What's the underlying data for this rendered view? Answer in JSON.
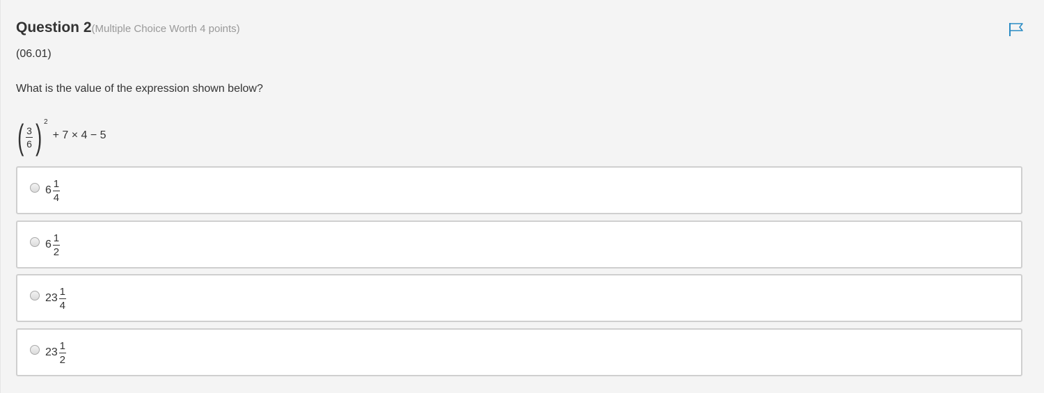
{
  "question": {
    "title": "Question 2",
    "subtitle": "(Multiple Choice Worth 4 points)",
    "code": "(06.01)",
    "prompt": "What is the value of the expression shown below?",
    "flag_icon": "flag-icon"
  },
  "expression": {
    "numerator": "3",
    "denominator": "6",
    "exponent": "2",
    "rest": "+ 7 × 4 − 5"
  },
  "options": [
    {
      "whole": "6",
      "numerator": "1",
      "denominator": "4"
    },
    {
      "whole": "6",
      "numerator": "1",
      "denominator": "2"
    },
    {
      "whole": "23",
      "numerator": "1",
      "denominator": "4"
    },
    {
      "whole": "23",
      "numerator": "1",
      "denominator": "2"
    }
  ],
  "colors": {
    "background": "#f4f4f4",
    "option_border": "#cfcfcf",
    "flag": "#2a8bc4"
  }
}
